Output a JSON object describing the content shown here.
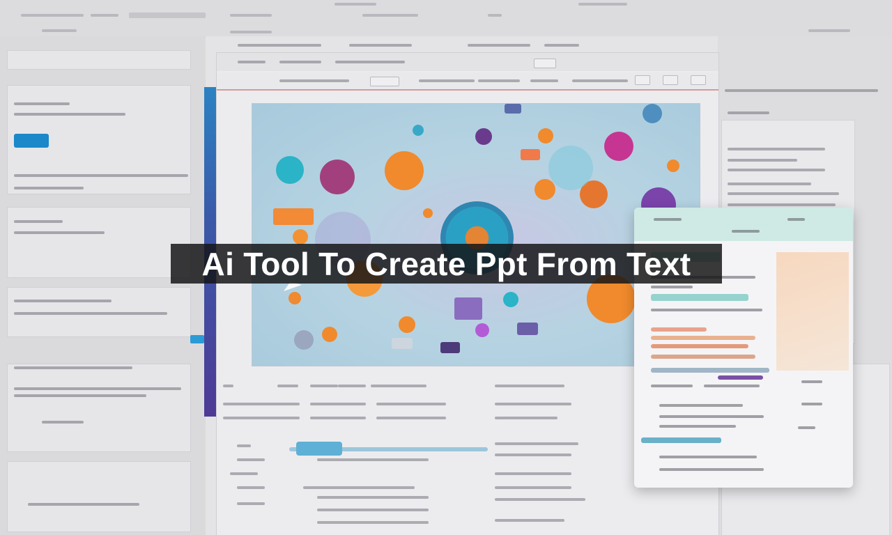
{
  "title": "Ai Tool To Create Ppt From Text",
  "colors": {
    "accent_blue": "#1a88c9",
    "accent_orange": "#f08a2c",
    "accent_purple": "#7b3fa0",
    "accent_teal": "#2fb3c6",
    "banner_background": "#141416",
    "banner_text": "#ffffff"
  },
  "icons": [
    "play-arrow-icon"
  ]
}
